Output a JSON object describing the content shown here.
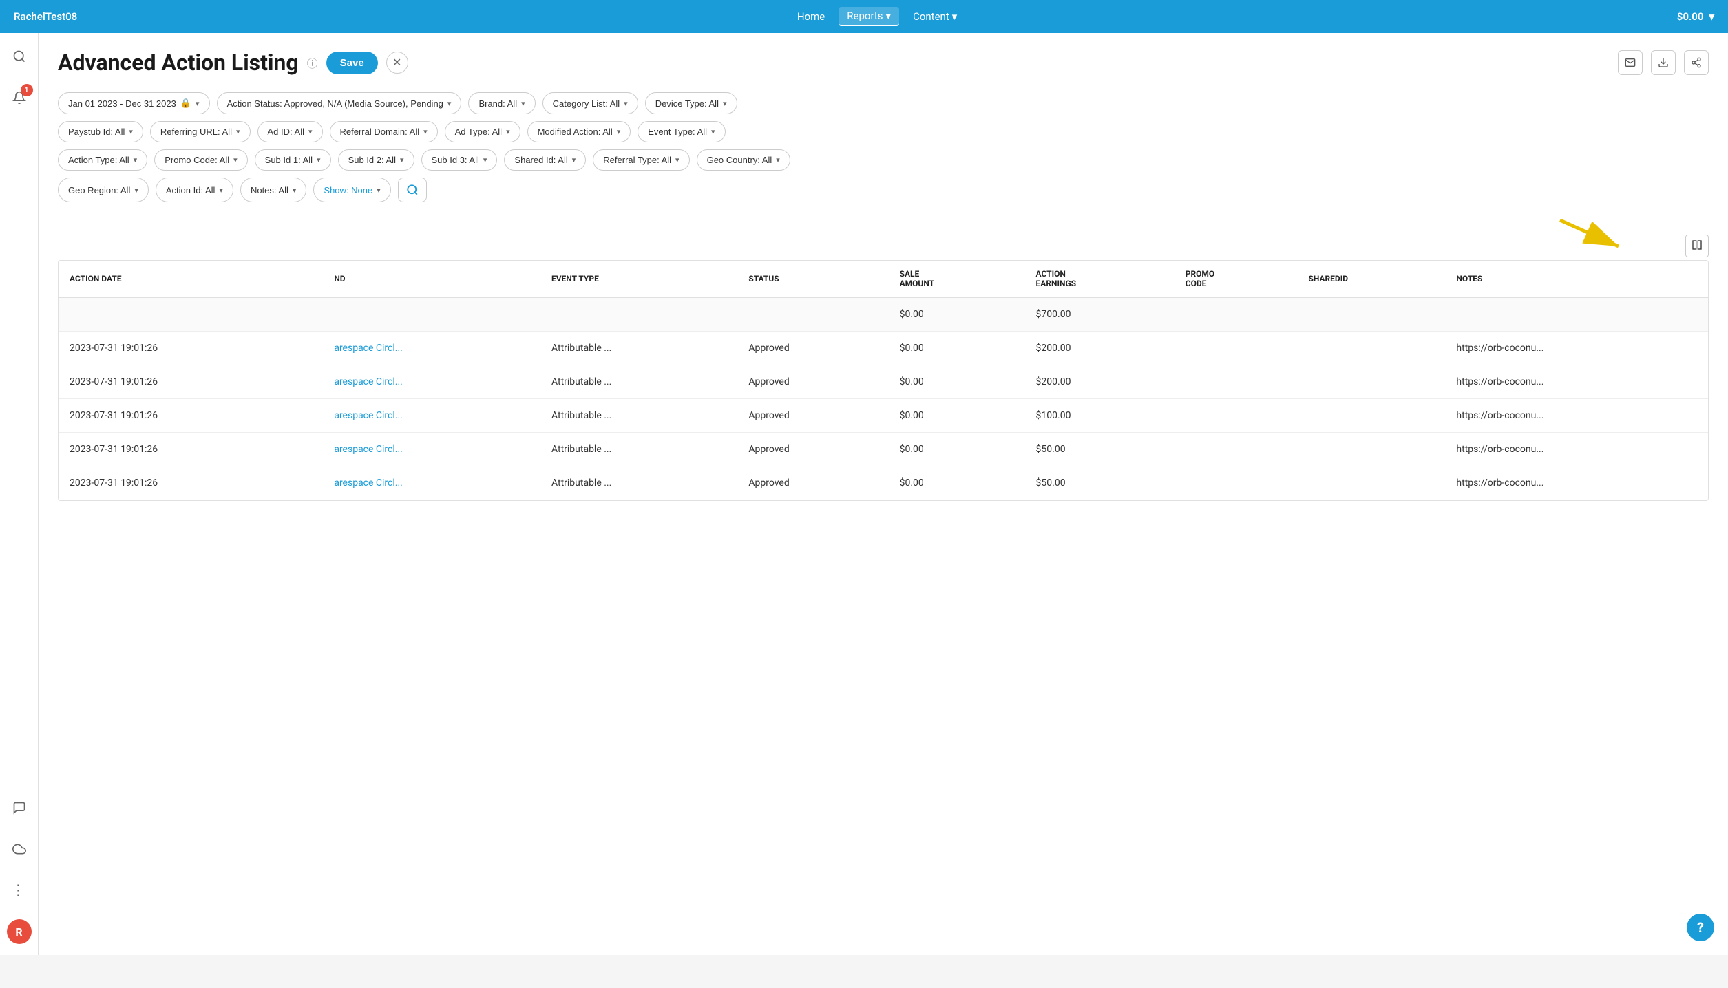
{
  "nav": {
    "brand": "RachelTest08",
    "links": [
      {
        "label": "Home",
        "active": false
      },
      {
        "label": "Reports",
        "active": true,
        "chevron": "▾"
      },
      {
        "label": "Content",
        "active": false,
        "chevron": "▾"
      }
    ],
    "balance": "$0.00",
    "balance_chevron": "▾"
  },
  "sidebar": {
    "icons": [
      {
        "name": "search-icon",
        "symbol": "🔍"
      },
      {
        "name": "notification-icon",
        "symbol": "🔔",
        "badge": "1"
      },
      {
        "name": "chat-icon",
        "symbol": "💬"
      },
      {
        "name": "cloud-icon",
        "symbol": "☁"
      },
      {
        "name": "more-icon",
        "symbol": "⋮"
      }
    ],
    "avatar_label": "R"
  },
  "page": {
    "title": "Advanced Action Listing",
    "save_label": "Save",
    "close_label": "✕"
  },
  "filters": {
    "date_range": "Jan 01 2023 - Dec 31 2023",
    "action_status": "Action Status: Approved, N/A (Media Source), Pending",
    "brand": "Brand: All",
    "category": "Category List: All",
    "device_type": "Device Type: All",
    "paystub_id": "Paystub Id: All",
    "referring_url": "Referring URL: All",
    "ad_id": "Ad ID: All",
    "referral_domain": "Referral Domain: All",
    "ad_type": "Ad Type: All",
    "modified_action": "Modified Action: All",
    "event_type": "Event Type: All",
    "action_type": "Action Type: All",
    "promo_code": "Promo Code: All",
    "sub_id1": "Sub Id 1: All",
    "sub_id2": "Sub Id 2: All",
    "sub_id3": "Sub Id 3: All",
    "shared_id": "Shared Id: All",
    "referral_type": "Referral Type: All",
    "geo_country": "Geo Country: All",
    "geo_region": "Geo Region: All",
    "action_id": "Action Id: All",
    "notes": "Notes: All",
    "show": "Show: None"
  },
  "table": {
    "columns": [
      "ACTION DATE",
      "ND",
      "EVENT TYPE",
      "STATUS",
      "SALE AMOUNT",
      "ACTION EARNINGS",
      "PROMO CODE",
      "SHAREDID",
      "NOTES"
    ],
    "totals_row": {
      "sale_amount": "$0.00",
      "action_earnings": "$700.00"
    },
    "rows": [
      {
        "action_date": "2023-07-31 19:01:26",
        "brand": "arespace Circl...",
        "event_type": "Attributable ...",
        "status": "Approved",
        "sale_amount": "$0.00",
        "action_earnings": "$200.00",
        "promo_code": "",
        "sharedid": "",
        "notes": "https://orb-coconu..."
      },
      {
        "action_date": "2023-07-31 19:01:26",
        "brand": "arespace Circl...",
        "event_type": "Attributable ...",
        "status": "Approved",
        "sale_amount": "$0.00",
        "action_earnings": "$200.00",
        "promo_code": "",
        "sharedid": "",
        "notes": "https://orb-coconu..."
      },
      {
        "action_date": "2023-07-31 19:01:26",
        "brand": "arespace Circl...",
        "event_type": "Attributable ...",
        "status": "Approved",
        "sale_amount": "$0.00",
        "action_earnings": "$100.00",
        "promo_code": "",
        "sharedid": "",
        "notes": "https://orb-coconu..."
      },
      {
        "action_date": "2023-07-31 19:01:26",
        "brand": "arespace Circl...",
        "event_type": "Attributable ...",
        "status": "Approved",
        "sale_amount": "$0.00",
        "action_earnings": "$50.00",
        "promo_code": "",
        "sharedid": "",
        "notes": "https://orb-coconu..."
      },
      {
        "action_date": "2023-07-31 19:01:26",
        "brand": "arespace Circl...",
        "event_type": "Attributable ...",
        "status": "Approved",
        "sale_amount": "$0.00",
        "action_earnings": "$50.00",
        "promo_code": "",
        "sharedid": "",
        "notes": "https://orb-coconu..."
      }
    ]
  },
  "help_bubble": "?"
}
